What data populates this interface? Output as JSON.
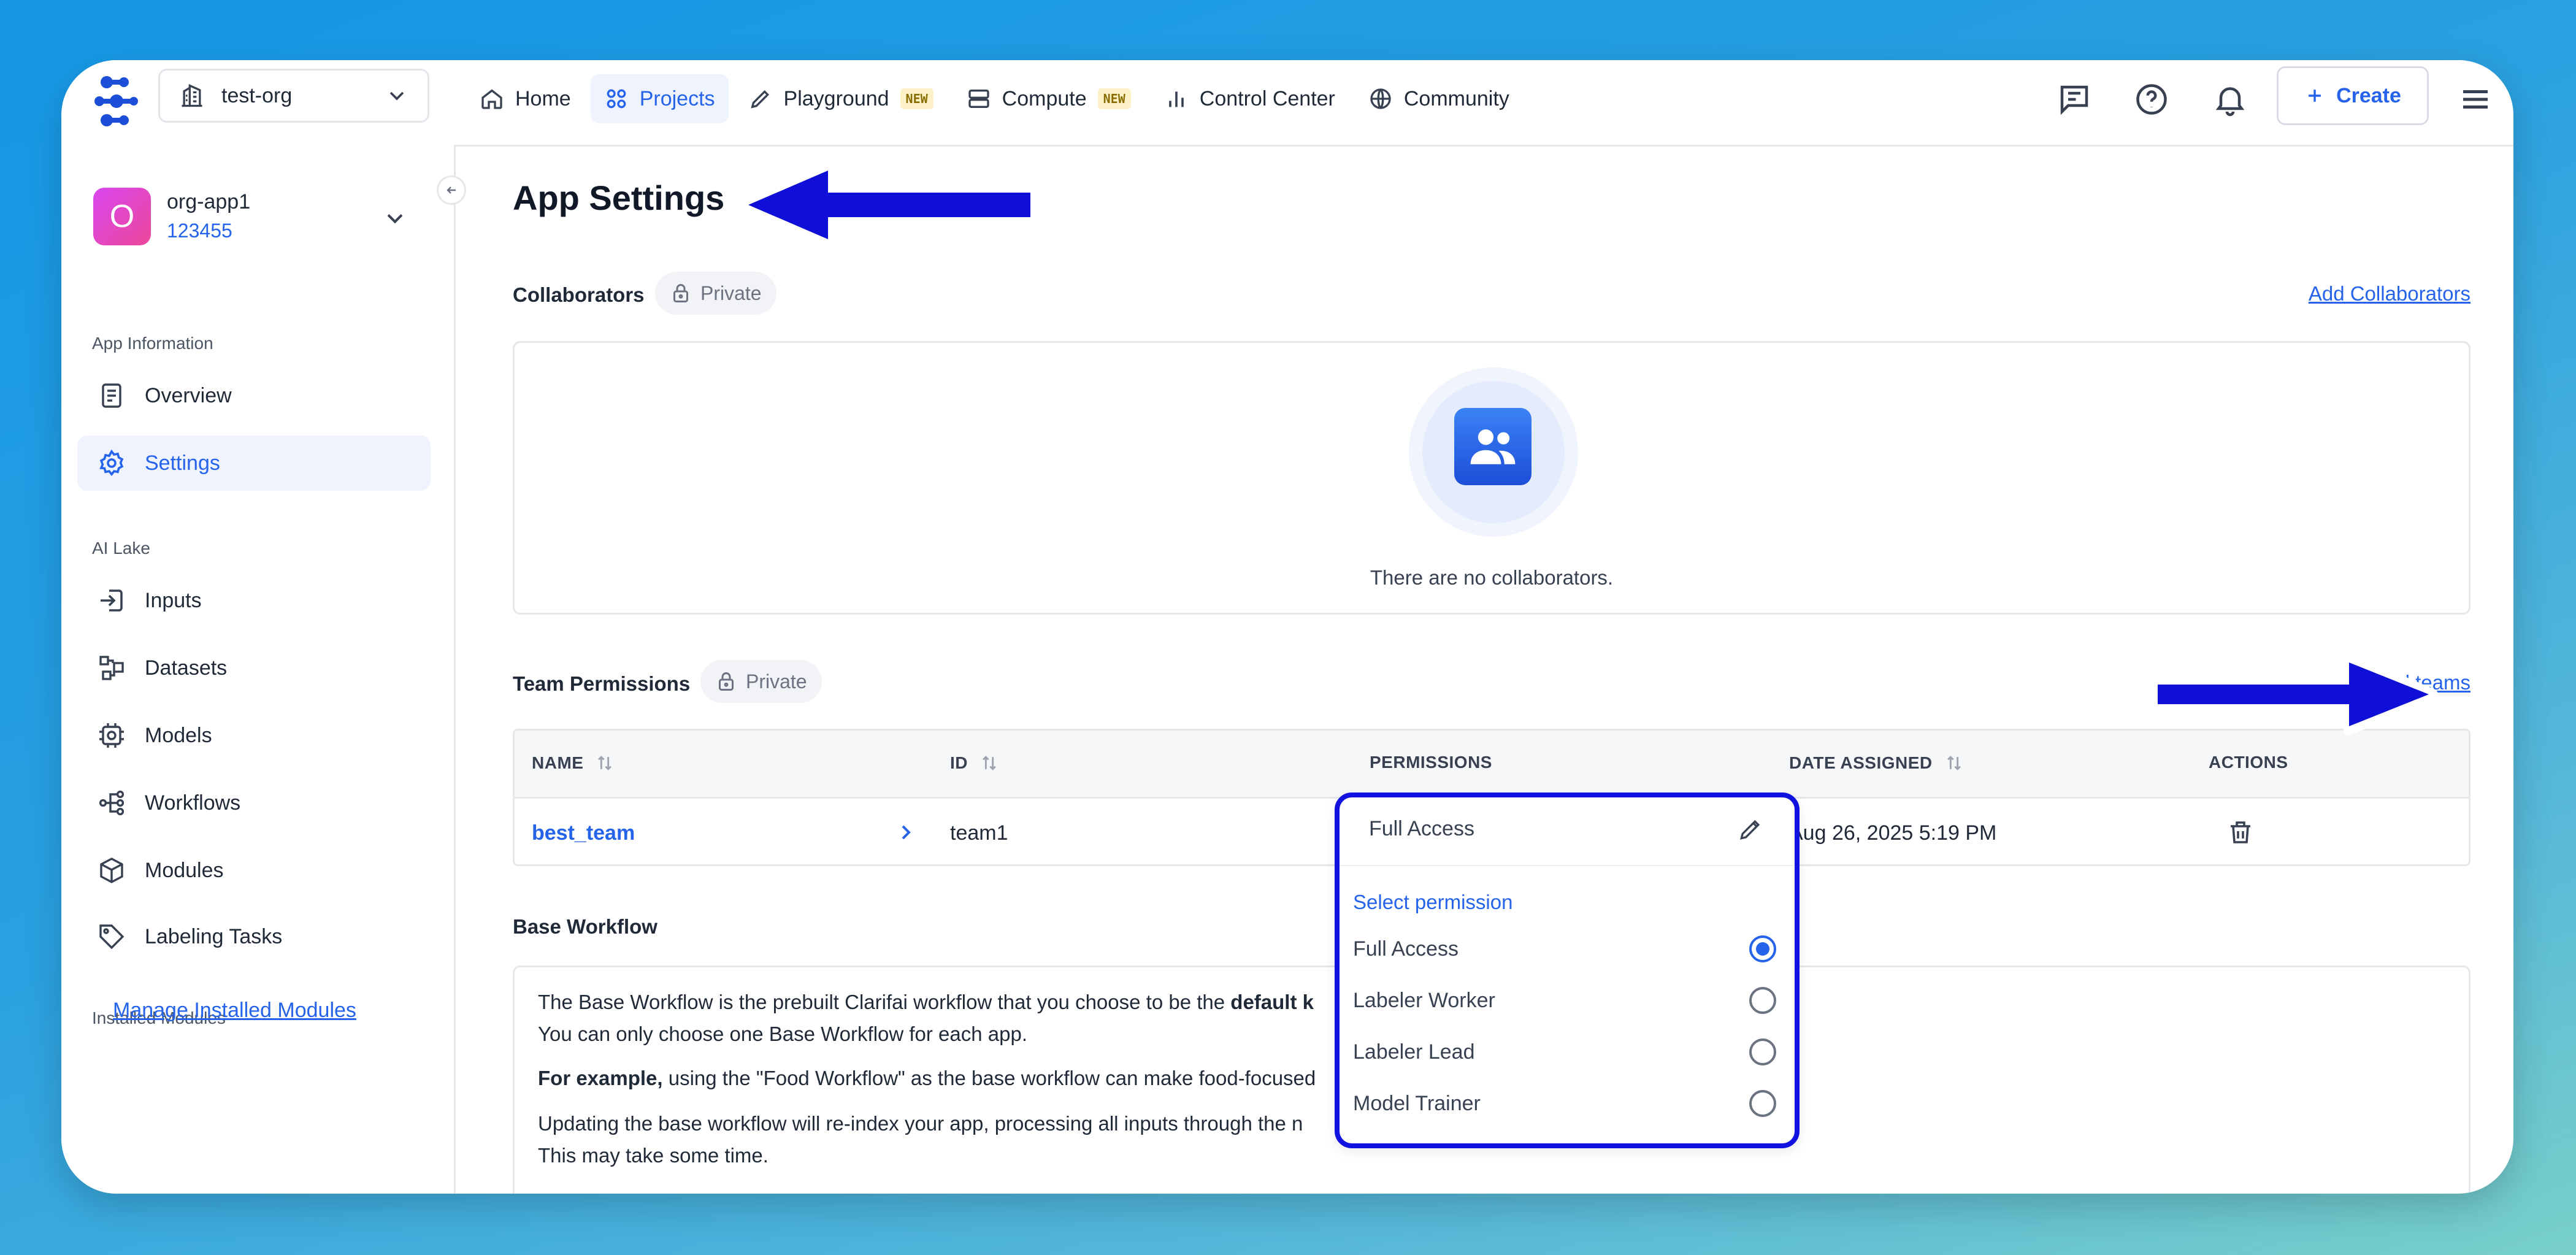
{
  "topbar": {
    "org": "test-org",
    "nav": [
      {
        "label": "Home",
        "icon": "home-icon",
        "active": false,
        "badge": ""
      },
      {
        "label": "Projects",
        "icon": "grid-icon",
        "active": true,
        "badge": ""
      },
      {
        "label": "Playground",
        "icon": "pencil-icon",
        "active": false,
        "badge": "NEW"
      },
      {
        "label": "Compute",
        "icon": "server-icon",
        "active": false,
        "badge": "NEW"
      },
      {
        "label": "Control Center",
        "icon": "bar-chart-icon",
        "active": false,
        "badge": ""
      },
      {
        "label": "Community",
        "icon": "globe-icon",
        "active": false,
        "badge": ""
      }
    ],
    "create_label": "Create",
    "icons": [
      "chat-icon",
      "help-icon",
      "bell-icon",
      "menu-icon"
    ]
  },
  "sidebar": {
    "app_avatar_letter": "O",
    "app_name": "org-app1",
    "app_id": "123455",
    "section_app_info": "App Information",
    "app_info_items": [
      {
        "label": "Overview",
        "icon": "document-icon",
        "active": false
      },
      {
        "label": "Settings",
        "icon": "gear-icon",
        "active": true
      }
    ],
    "section_ai_lake": "AI Lake",
    "ai_lake_items": [
      {
        "label": "Inputs",
        "icon": "input-icon"
      },
      {
        "label": "Datasets",
        "icon": "datasets-icon"
      },
      {
        "label": "Models",
        "icon": "chip-icon"
      },
      {
        "label": "Workflows",
        "icon": "workflow-icon"
      },
      {
        "label": "Modules",
        "icon": "cube-icon"
      },
      {
        "label": "Labeling Tasks",
        "icon": "tag-icon"
      }
    ],
    "section_installed": "Installed Modules",
    "manage_link": "Manage Installed Modules"
  },
  "main": {
    "title": "App Settings",
    "collaborators": {
      "label": "Collaborators",
      "private_label": "Private",
      "add_link": "Add Collaborators",
      "empty_text": "There are no collaborators."
    },
    "team_permissions": {
      "label": "Team Permissions",
      "private_label": "Private",
      "add_link": "Add teams",
      "columns": [
        "NAME",
        "ID",
        "PERMISSIONS",
        "DATE ASSIGNED",
        "ACTIONS"
      ],
      "rows": [
        {
          "name": "best_team",
          "id": "team1",
          "permission": "Full Access",
          "date": "Aug 26, 2025 5:19 PM"
        }
      ]
    },
    "permission_dropdown": {
      "current": "Full Access",
      "heading": "Select permission",
      "options": [
        {
          "label": "Full Access",
          "selected": true
        },
        {
          "label": "Labeler Worker",
          "selected": false
        },
        {
          "label": "Labeler Lead",
          "selected": false
        },
        {
          "label": "Model Trainer",
          "selected": false
        }
      ]
    },
    "base_workflow": {
      "label": "Base Workflow",
      "line1_pre": "The Base Workflow is the prebuilt Clarifai workflow that you choose to be the ",
      "line1_bold": "default k",
      "line2": "You can only choose one Base Workflow for each app.",
      "line3_bold": "For example,",
      "line3_rest": " using the \"Food Workflow\" as the base workflow can make food-focused",
      "line4": "Updating the base workflow will re-index your app, processing all inputs through the n",
      "line5": "This may take some time."
    }
  },
  "colors": {
    "accent": "#2563eb",
    "annotation_blue": "#1212e0",
    "active_bg": "#eef3fe",
    "background_gradient_start": "#1597e5",
    "background_gradient_end": "#78cfc8"
  }
}
